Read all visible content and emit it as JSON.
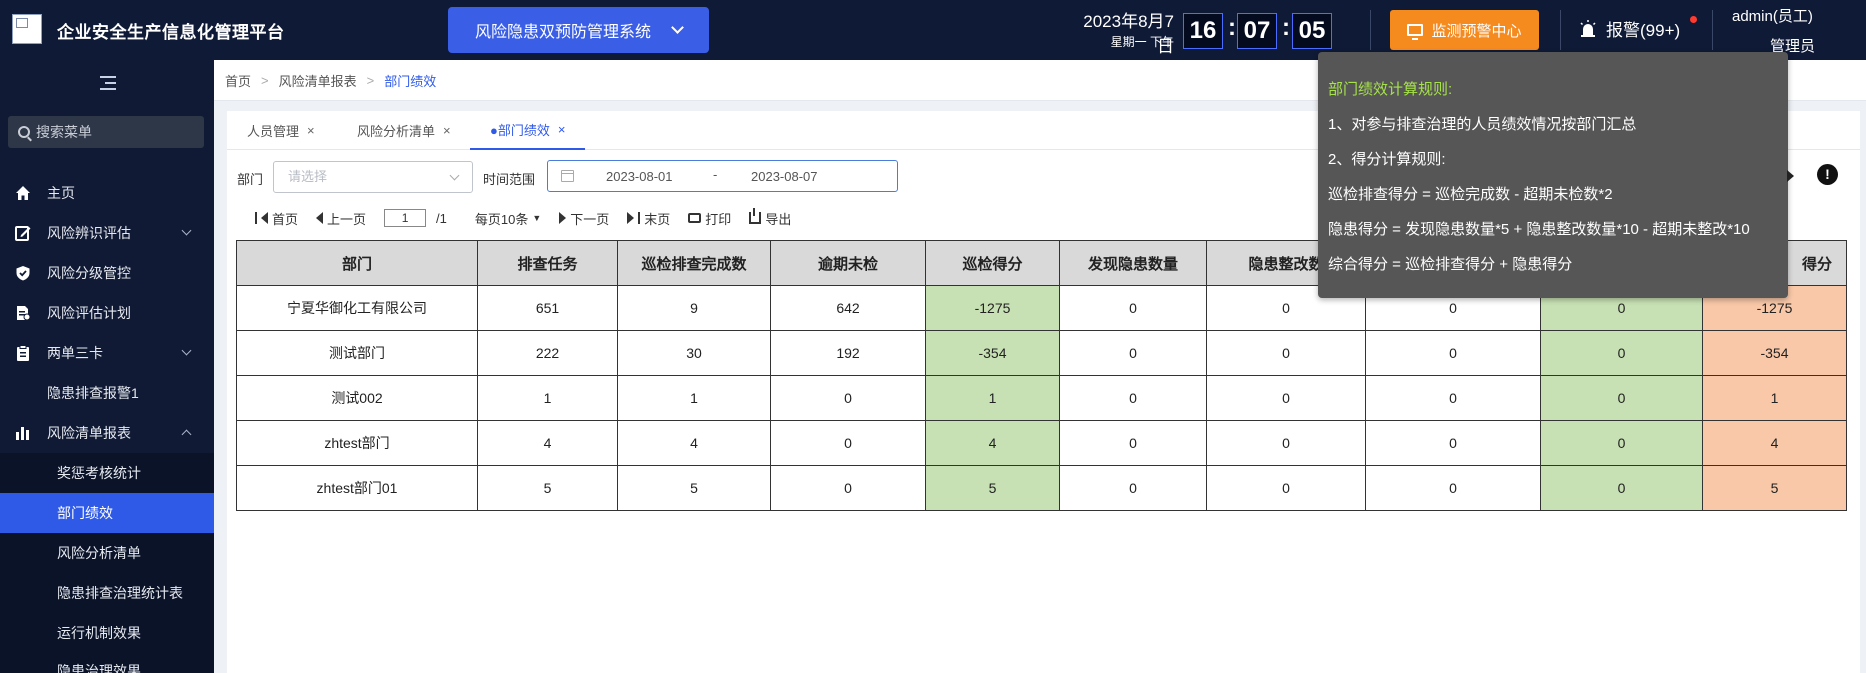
{
  "header": {
    "app_title": "企业安全生产信息化管理平台",
    "system_select": "风险隐患双预防管理系统",
    "date": "2023年8月7日",
    "weekday": "星期一  下午",
    "clock": {
      "h": "16",
      "m": "07",
      "s": "05",
      "sep": ":"
    },
    "monitor_button": "监测预警中心",
    "alarm": "报警(99+)",
    "user_name": "admin(员工)",
    "user_role": "管理员",
    "colors": {
      "topbar": "#0f1a36",
      "system_select": "#3a5fe6",
      "monitor": "#f58a1f",
      "alarm_dot": "#ff3b30"
    }
  },
  "sidebar": {
    "search_placeholder": "搜索菜单",
    "items": [
      {
        "label": "主页",
        "icon": "home-icon"
      },
      {
        "label": "风险辨识评估",
        "icon": "edit-icon"
      },
      {
        "label": "风险分级管控",
        "icon": "shield-icon"
      },
      {
        "label": "风险评估计划",
        "icon": "doc-icon"
      },
      {
        "label": "两单三卡",
        "icon": "clipboard-icon"
      },
      {
        "label": "隐患排查报警1"
      },
      {
        "label": "风险清单报表",
        "icon": "bar-chart-icon"
      },
      {
        "label": "奖惩考核统计"
      },
      {
        "label": "部门绩效"
      },
      {
        "label": "风险分析清单"
      },
      {
        "label": "隐患排查治理统计表"
      },
      {
        "label": "运行机制效果"
      },
      {
        "label": "隐患治理效果"
      }
    ],
    "active_color": "#2f5ae8"
  },
  "breadcrumb": [
    "首页",
    "风险清单报表",
    "部门绩效"
  ],
  "tabs": [
    {
      "label": "人员管理",
      "close": "×"
    },
    {
      "label": "风险分析清单",
      "close": "×"
    },
    {
      "label": "●部门绩效",
      "close": "×"
    }
  ],
  "filters": {
    "dept_label": "部门",
    "dept_placeholder": "请选择",
    "time_label": "时间范围",
    "start_date": "2023-08-01",
    "range_sep": "-",
    "end_date": "2023-08-07"
  },
  "pager": {
    "first": "首页",
    "prev": "上一页",
    "page": "1",
    "total": "/1",
    "page_size": "每页10条",
    "next": "下一页",
    "last": "末页",
    "print": "打印",
    "export": "导出"
  },
  "table": {
    "headers": [
      "部门",
      "排查任务",
      "巡检排查完成数",
      "逾期未检",
      "巡检得分",
      "发现隐患数量",
      "隐患整改数",
      "",
      "",
      "得分"
    ],
    "rows": [
      [
        "宁夏华御化工有限公司",
        "651",
        "9",
        "642",
        "-1275",
        "0",
        "0",
        "0",
        "0",
        "-1275"
      ],
      [
        "测试部门",
        "222",
        "30",
        "192",
        "-354",
        "0",
        "0",
        "0",
        "0",
        "-354"
      ],
      [
        "测试002",
        "1",
        "1",
        "0",
        "1",
        "0",
        "0",
        "0",
        "0",
        "1"
      ],
      [
        "zhtest部门",
        "4",
        "4",
        "0",
        "4",
        "0",
        "0",
        "0",
        "0",
        "4"
      ],
      [
        "zhtest部门01",
        "5",
        "5",
        "0",
        "5",
        "0",
        "0",
        "0",
        "0",
        "5"
      ]
    ],
    "colors": {
      "header": "#d9d9d9",
      "green": "#c8e1b4",
      "orange": "#f8c8a8"
    }
  },
  "tooltip": {
    "title": "部门绩效计算规则:",
    "lines": [
      "1、对参与排查治理的人员绩效情况按部门汇总",
      "2、得分计算规则:",
      "巡检排查得分 = 巡检完成数 - 超期未检数*2",
      "隐患得分 = 发现隐患数量*5 + 隐患整改数量*10 - 超期未整改*10",
      "综合得分 = 巡检排查得分 + 隐患得分"
    ],
    "help": "!"
  }
}
